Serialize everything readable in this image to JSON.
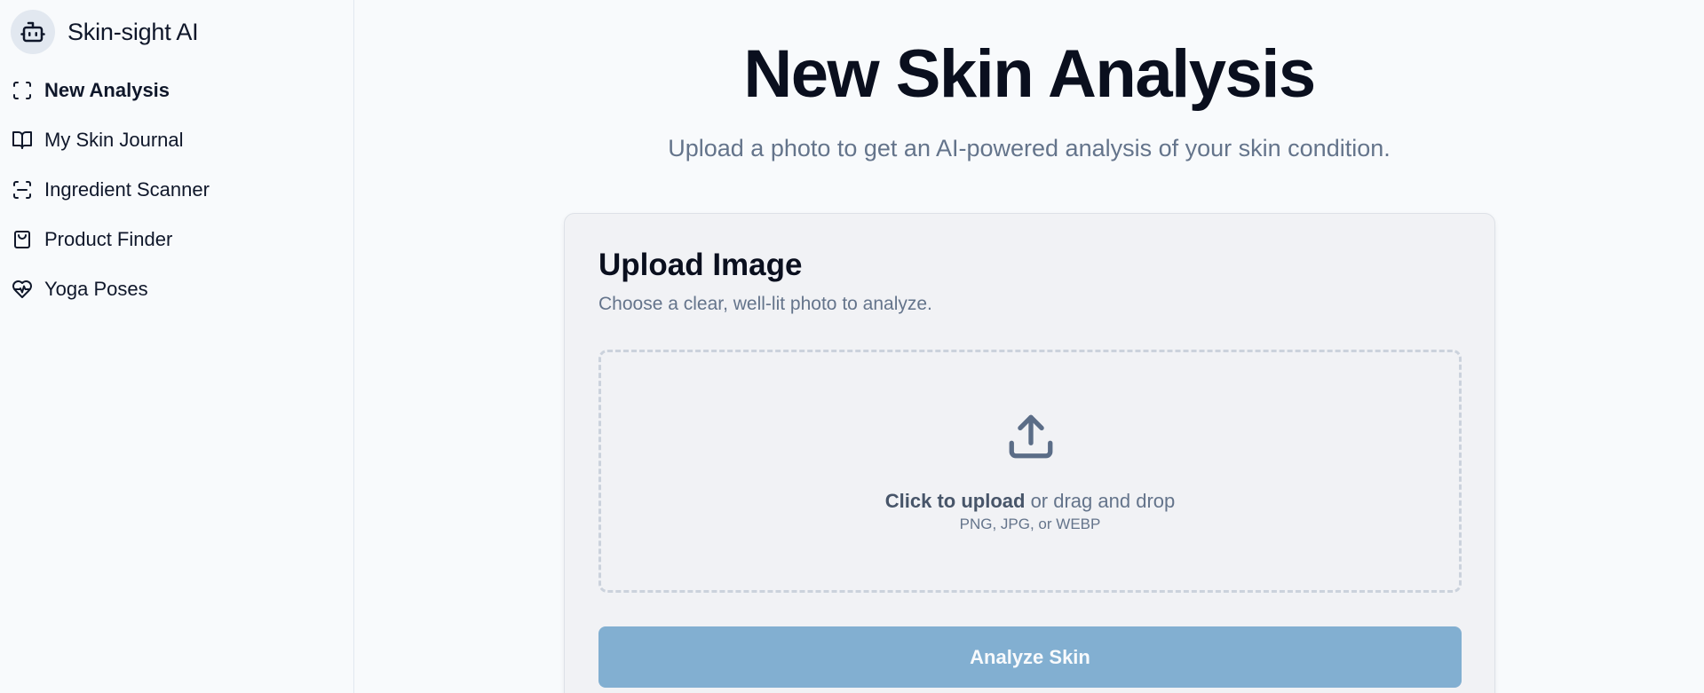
{
  "brand": {
    "name": "Skin-sight AI",
    "icon": "robot-icon"
  },
  "sidebar": {
    "items": [
      {
        "label": "New Analysis",
        "icon": "scan-frame-icon",
        "active": true
      },
      {
        "label": "My Skin Journal",
        "icon": "book-open-icon",
        "active": false
      },
      {
        "label": "Ingredient Scanner",
        "icon": "scan-line-icon",
        "active": false
      },
      {
        "label": "Product Finder",
        "icon": "shopping-bag-icon",
        "active": false
      },
      {
        "label": "Yoga Poses",
        "icon": "heart-pulse-icon",
        "active": false
      }
    ]
  },
  "main": {
    "title": "New Skin Analysis",
    "subtitle": "Upload a photo to get an AI-powered analysis of your skin condition."
  },
  "upload_card": {
    "title": "Upload Image",
    "description": "Choose a clear, well-lit photo to analyze.",
    "dropzone": {
      "icon": "upload-icon",
      "click_text": "Click to upload",
      "drag_text": " or drag and drop",
      "formats": "PNG, JPG, or WEBP"
    },
    "analyze_label": "Analyze Skin"
  },
  "colors": {
    "accent_button": "#82afd1",
    "text_primary": "#0f172a",
    "text_muted": "#64748b",
    "background": "#f8fafc"
  }
}
